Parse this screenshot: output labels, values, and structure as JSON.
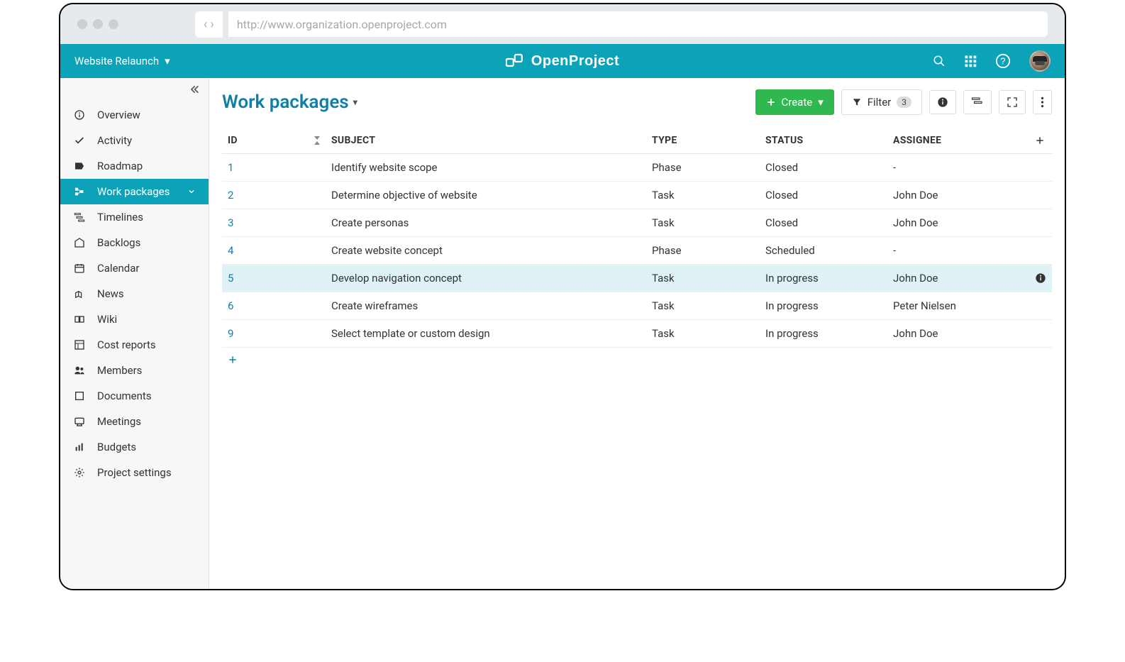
{
  "browser": {
    "url": "http://www.organization.openproject.com"
  },
  "project": {
    "name": "Website Relaunch"
  },
  "brand": {
    "name": "OpenProject"
  },
  "sidebar": {
    "items": [
      {
        "label": "Overview"
      },
      {
        "label": "Activity"
      },
      {
        "label": "Roadmap"
      },
      {
        "label": "Work packages",
        "active": true
      },
      {
        "label": "Timelines"
      },
      {
        "label": "Backlogs"
      },
      {
        "label": "Calendar"
      },
      {
        "label": "News"
      },
      {
        "label": "Wiki"
      },
      {
        "label": "Cost reports"
      },
      {
        "label": "Members"
      },
      {
        "label": "Documents"
      },
      {
        "label": "Meetings"
      },
      {
        "label": "Budgets"
      },
      {
        "label": "Project settings"
      }
    ]
  },
  "page": {
    "title": "Work packages"
  },
  "toolbar": {
    "create_label": "Create",
    "filter_label": "Filter",
    "filter_count": "3"
  },
  "table": {
    "columns": {
      "id": "ID",
      "subject": "SUBJECT",
      "type": "TYPE",
      "status": "STATUS",
      "assignee": "ASSIGNEE"
    },
    "rows": [
      {
        "id": "1",
        "subject": "Identify website scope",
        "type": "Phase",
        "status": "Closed",
        "assignee": "-"
      },
      {
        "id": "2",
        "subject": "Determine objective of website",
        "type": "Task",
        "status": "Closed",
        "assignee": "John Doe"
      },
      {
        "id": "3",
        "subject": "Create personas",
        "type": "Task",
        "status": "Closed",
        "assignee": "John Doe"
      },
      {
        "id": "4",
        "subject": "Create website concept",
        "type": "Phase",
        "status": "Scheduled",
        "assignee": "-"
      },
      {
        "id": "5",
        "subject": "Develop navigation concept",
        "type": "Task",
        "status": "In progress",
        "assignee": "John Doe",
        "highlight": true,
        "info": true
      },
      {
        "id": "6",
        "subject": "Create wireframes",
        "type": "Task",
        "status": "In progress",
        "assignee": "Peter Nielsen"
      },
      {
        "id": "9",
        "subject": "Select template or custom design",
        "type": "Task",
        "status": "In progress",
        "assignee": "John Doe"
      }
    ]
  }
}
